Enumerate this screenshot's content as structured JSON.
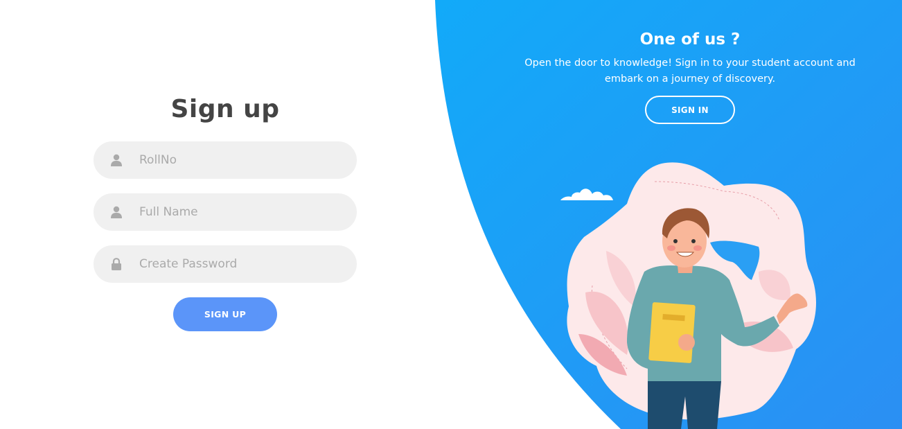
{
  "colors": {
    "panel_start": "#12aaf9",
    "panel_end": "#2b8ff3",
    "button_primary": "#5b95f9",
    "title_text": "#444444",
    "input_bg": "#f0f0f0",
    "placeholder": "#aaaaaa"
  },
  "signup": {
    "title": "Sign up",
    "rollno": {
      "placeholder": "RollNo",
      "icon": "user-icon"
    },
    "fullname": {
      "placeholder": "Full Name",
      "icon": "user-icon"
    },
    "password": {
      "placeholder": "Create Password",
      "icon": "lock-icon"
    },
    "button_label": "SIGN UP"
  },
  "panel": {
    "title": "One of us ?",
    "text": "Open the door to knowledge! Sign in to your student account and embark on a journey of discovery.",
    "button_label": "SIGN IN",
    "illustration": "student-with-book-illustration"
  }
}
